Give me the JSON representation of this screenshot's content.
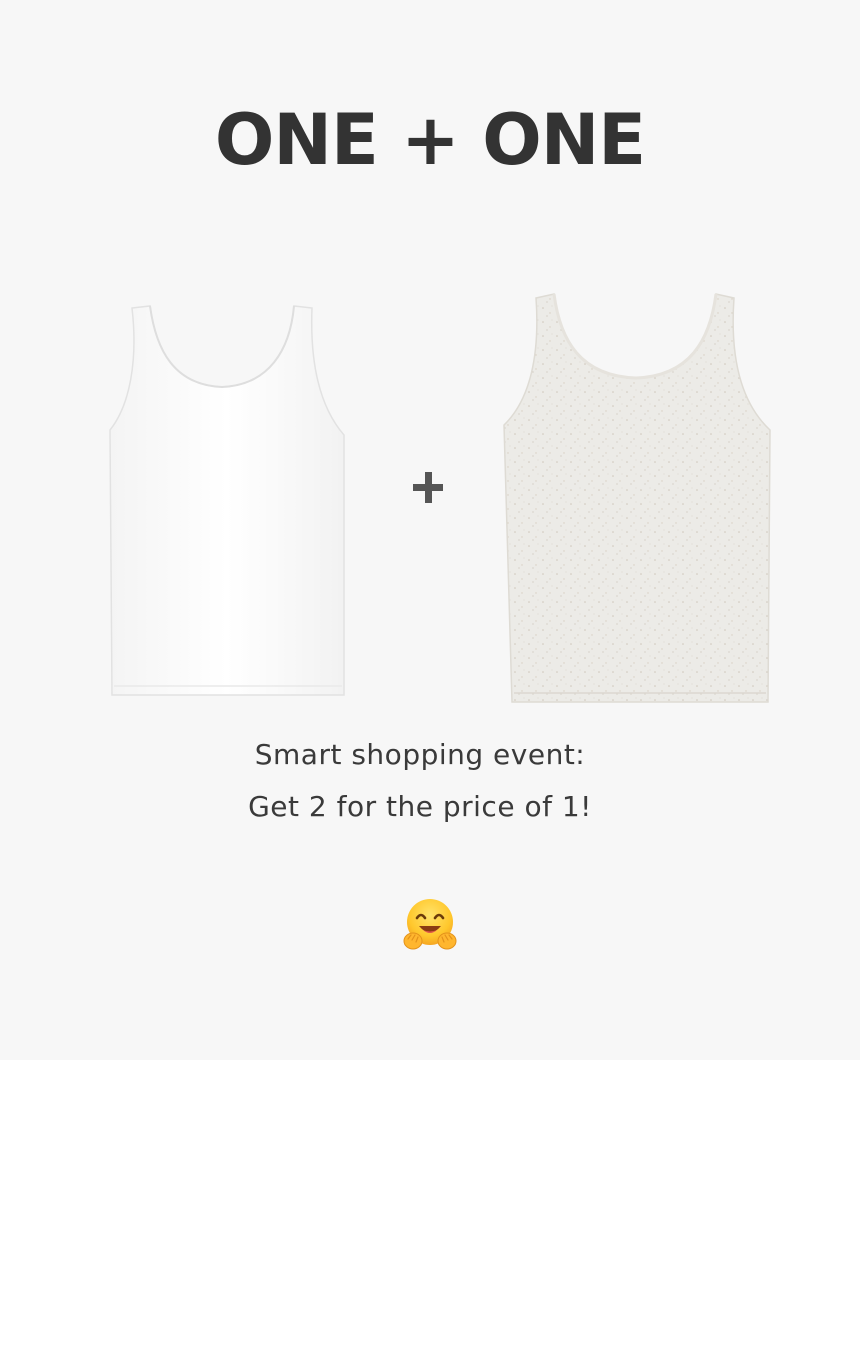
{
  "promo": {
    "headline": "ONE + ONE",
    "caption_line1": "Smart shopping event:",
    "caption_line2": "Get 2 for the price of 1!",
    "products": [
      {
        "name": "white tank top",
        "color": "#ffffff"
      },
      {
        "name": "oatmeal speckled tank top",
        "color": "#ecebe7"
      }
    ],
    "separator_icon": "plus-icon",
    "emoji_icon": "hugging-face-icon"
  },
  "colors": {
    "promo_background": "#f7f7f7",
    "page_background": "#ffffff",
    "headline": "#333333",
    "caption": "#3a3a3a",
    "plus": "#555555"
  }
}
